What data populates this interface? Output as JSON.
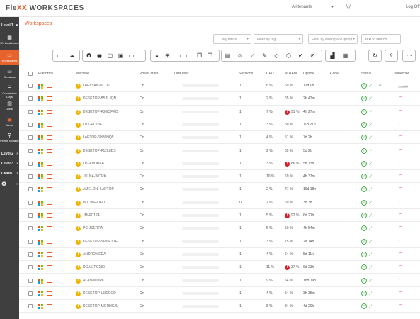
{
  "app": {
    "logo_prefix": "Fle",
    "logo_x": "XX",
    "logo_suffix": "WORKSPACES",
    "tenants": "All tenants",
    "tenants_caret": "▾",
    "logoff": "Log Off",
    "bulb_icon": "lightbulb-icon"
  },
  "sidebar": {
    "level1": "Level 1",
    "items": [
      {
        "label": "UX Dashboard",
        "icon": "dashboard-icon"
      },
      {
        "label": "Workspaces",
        "icon": "monitor-icon",
        "active": true
      },
      {
        "label": "Sessions",
        "icon": "sessions-icon"
      },
      {
        "label": "Connection Logs",
        "icon": "list-icon"
      },
      {
        "label": "Jobs",
        "icon": "document-icon"
      },
      {
        "label": "Alerts",
        "icon": "alert-icon"
      },
      {
        "label": "Profile Storage",
        "icon": "profile-icon"
      }
    ],
    "levels": [
      "Level 2",
      "Level 3",
      "CMDB"
    ],
    "settings_icon": "gear-icon"
  },
  "page": {
    "title": "Workspaces"
  },
  "filters": {
    "my_filters": "My filters",
    "by_tag": "Filter by tag",
    "by_group": "Filter by workspace group",
    "search": "Text to search"
  },
  "columns": {
    "platforms": "Platforms",
    "machine": "Machine",
    "power": "Power state",
    "last_user": "Last user",
    "sessions": "Sessions",
    "cpu": "CPU",
    "ram": "% RAM",
    "uptime": "Uptime",
    "code": "Code",
    "status": "Status",
    "connection": "Connection"
  },
  "rows": [
    {
      "machine": "LAPLSAN-PC181",
      "power": "On",
      "sessions": "1",
      "cpu": "6 %",
      "ram": "69 %",
      "uptime": "12d 0h",
      "ram_alert": false,
      "connection": "weak"
    },
    {
      "machine": "DESKTOP-B52LJQN",
      "power": "On",
      "sessions": "1",
      "cpu": "2 %",
      "ram": "65 %",
      "uptime": "2h 47m",
      "ram_alert": false,
      "connection": "wifi"
    },
    {
      "machine": "DESKTOP-F3GQPKO",
      "power": "On",
      "sessions": "1",
      "cpu": "7 %",
      "ram": "91 %",
      "uptime": "4h 27m",
      "ram_alert": true,
      "connection": "wifi"
    },
    {
      "machine": "LNX-PC184",
      "power": "On",
      "sessions": "1",
      "cpu": "3 %",
      "ram": "50 %",
      "uptime": "11d 21h",
      "ram_alert": false,
      "connection": "wifi"
    },
    {
      "machine": "LAPTOP-6H36HQ5",
      "power": "On",
      "sessions": "1",
      "cpu": "4 %",
      "ram": "51 %",
      "uptime": "7d 2h",
      "ram_alert": false,
      "connection": "wifi"
    },
    {
      "machine": "DESKTOP-F12L8DS",
      "power": "On",
      "sessions": "1",
      "cpu": "2 %",
      "ram": "69 %",
      "uptime": "5d 2h",
      "ram_alert": false,
      "connection": "wifi"
    },
    {
      "machine": "LP-IANDREA",
      "power": "On",
      "sessions": "1",
      "cpu": "3 %",
      "ram": "86 %",
      "uptime": "5d 13h",
      "ram_alert": true,
      "connection": "wifi"
    },
    {
      "machine": "JLUNA-WORK",
      "power": "On",
      "sessions": "1",
      "cpu": "10 %",
      "ram": "69 %",
      "uptime": "4h 37m",
      "ram_alert": false,
      "connection": "wifi"
    },
    {
      "machine": "AMELONI-LAPTOP",
      "power": "On",
      "sessions": "1",
      "cpu": "2 %",
      "ram": "47 %",
      "uptime": "16d 18h",
      "ram_alert": false,
      "connection": "wifi"
    },
    {
      "machine": "INTUNE-DELL",
      "power": "On",
      "sessions": "0",
      "cpu": "2 %",
      "ram": "69 %",
      "uptime": "3d 3h",
      "ram_alert": false,
      "connection": "wifi"
    },
    {
      "machine": "JM-PC124",
      "power": "On",
      "sessions": "1",
      "cpu": "5 %",
      "ram": "92 %",
      "uptime": "6d 21h",
      "ram_alert": true,
      "connection": "wifi"
    },
    {
      "machine": "PC-JSERRA",
      "power": "On",
      "sessions": "1",
      "cpu": "5 %",
      "ram": "50 %",
      "uptime": "4h 54m",
      "ram_alert": false,
      "connection": "wifi"
    },
    {
      "machine": "DESKTOP-SPMETTE",
      "power": "On",
      "sessions": "1",
      "cpu": "3 %",
      "ram": "75 %",
      "uptime": "2d 14h",
      "ram_alert": false,
      "connection": "wifi"
    },
    {
      "machine": "ANDROMEDA",
      "power": "On",
      "sessions": "1",
      "cpu": "4 %",
      "ram": "64 %",
      "uptime": "5d 11h",
      "ram_alert": false,
      "connection": "wifi"
    },
    {
      "machine": "DCAS-PC180",
      "power": "On",
      "sessions": "1",
      "cpu": "11 %",
      "ram": "37 %",
      "uptime": "6d 23h",
      "ram_alert": true,
      "connection": "wifi"
    },
    {
      "machine": "ALAN-WORK",
      "power": "On",
      "sessions": "1",
      "cpu": "9 %",
      "ram": "64 %",
      "uptime": "18d 19h",
      "ram_alert": false,
      "connection": "wifi"
    },
    {
      "machine": "DESKTOP-L5ICEOD",
      "power": "On",
      "sessions": "1",
      "cpu": "4 %",
      "ram": "54 %",
      "uptime": "3h 35m",
      "ram_alert": false,
      "connection": "wifi"
    },
    {
      "machine": "DESKTOP-MGRHCJU",
      "power": "On",
      "sessions": "1",
      "cpu": "8 %",
      "ram": "84 %",
      "uptime": "4d 20h",
      "ram_alert": false,
      "connection": "wifi"
    }
  ],
  "colors": {
    "accent": "#e8622c",
    "sidebar": "#3f3f3f",
    "ok": "#4caf50",
    "alert": "#d7232f",
    "warn": "#f0b400"
  }
}
